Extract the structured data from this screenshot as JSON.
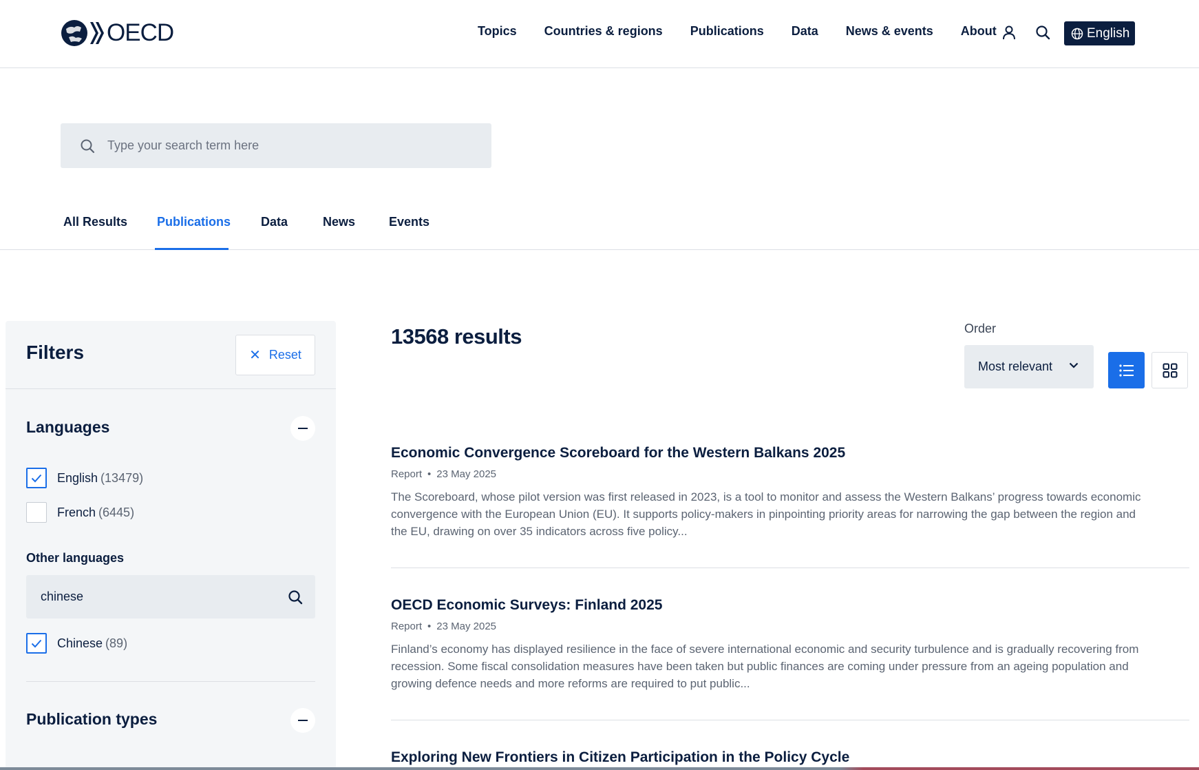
{
  "header": {
    "logo_text": "OECD",
    "nav": [
      "Topics",
      "Countries & regions",
      "Publications",
      "Data",
      "News & events",
      "About"
    ],
    "language": "English"
  },
  "search": {
    "placeholder": "Type your search term here",
    "value": ""
  },
  "tabs": [
    {
      "label": "All Results",
      "active": false
    },
    {
      "label": "Publications",
      "active": true
    },
    {
      "label": "Data",
      "active": false
    },
    {
      "label": "News",
      "active": false
    },
    {
      "label": "Events",
      "active": false
    }
  ],
  "filters": {
    "title": "Filters",
    "reset_label": "Reset",
    "languages": {
      "title": "Languages",
      "items": [
        {
          "label": "English",
          "count": "(13479)",
          "checked": true
        },
        {
          "label": "French",
          "count": "(6445)",
          "checked": false
        }
      ],
      "other_title": "Other languages",
      "other_search_value": "chinese",
      "other_items": [
        {
          "label": "Chinese",
          "count": "(89)",
          "checked": true
        }
      ]
    },
    "publication_types": {
      "title": "Publication types"
    }
  },
  "results": {
    "count_label": "13568 results",
    "order_label": "Order",
    "order_value": "Most relevant",
    "items": [
      {
        "title": "Economic Convergence Scoreboard for the Western Balkans 2025",
        "type": "Report",
        "date": "23 May 2025",
        "description": "The Scoreboard, whose pilot version was first released in 2023, is a tool to monitor and assess the Western Balkans’ progress towards economic convergence with the European Union (EU). It supports policy-makers in pinpointing priority areas for narrowing the gap between the region and the EU, drawing on over 35 indicators across five policy..."
      },
      {
        "title": "OECD Economic Surveys: Finland 2025",
        "type": "Report",
        "date": "23 May 2025",
        "description": "Finland’s economy has displayed resilience in the face of severe international economic and security turbulence and is gradually recovering from recession. Some fiscal consolidation measures have been taken but public finances are coming under pressure from an ageing population and growing defence needs and more reforms are required to put public..."
      },
      {
        "title": "Exploring New Frontiers in Citizen Participation in the Policy Cycle"
      }
    ]
  },
  "colors": {
    "brand_navy": "#0b1e3f",
    "accent_blue": "#1a6ee8",
    "panel_bg": "#f4f6f8"
  },
  "icons": [
    "oecd-logo-icon",
    "user-icon",
    "search-icon",
    "globe-icon",
    "close-icon",
    "minus-icon",
    "check-icon",
    "chevron-down-icon",
    "list-view-icon",
    "grid-view-icon"
  ]
}
